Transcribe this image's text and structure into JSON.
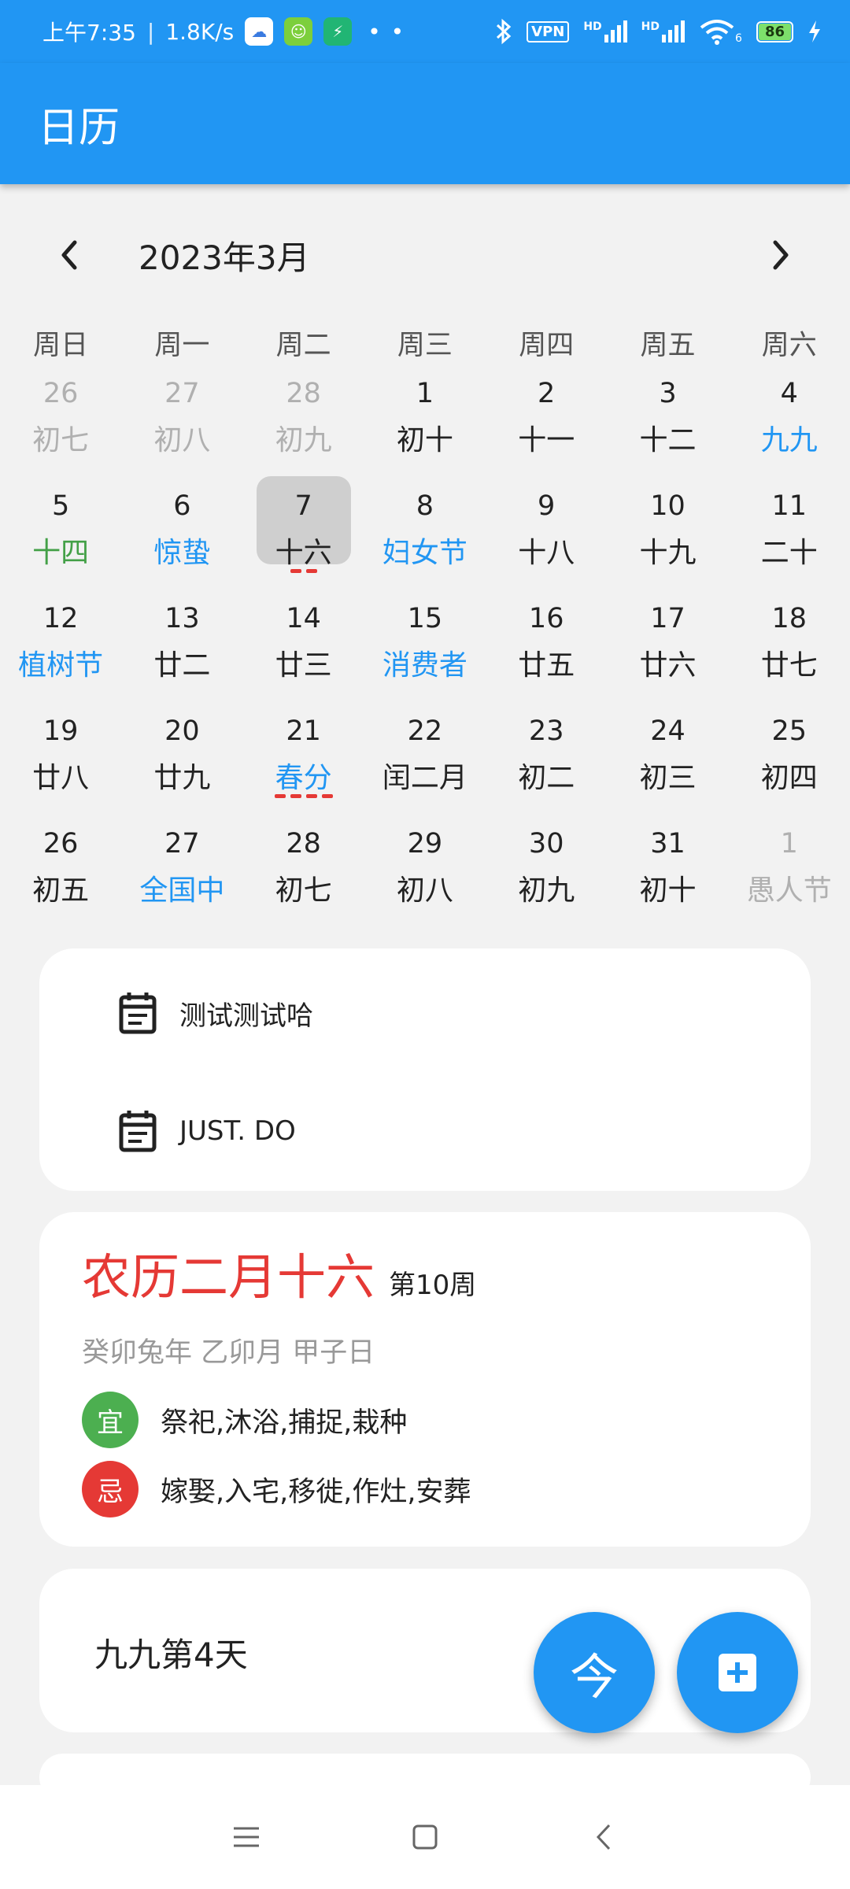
{
  "status_bar": {
    "time": "上午7:35",
    "speed": "1.8K/s",
    "vpn": "VPN",
    "signal1": "HD",
    "signal2": "HD",
    "battery": "86",
    "wifi_index": "6",
    "more": "• •"
  },
  "app_bar": {
    "title": "日历"
  },
  "month_nav": {
    "title": "2023年3月"
  },
  "weekdays": [
    "周日",
    "周一",
    "周二",
    "周三",
    "周四",
    "周五",
    "周六"
  ],
  "calendar": {
    "weeks": [
      [
        {
          "num": "26",
          "lunar": "初七",
          "other": true
        },
        {
          "num": "27",
          "lunar": "初八",
          "other": true
        },
        {
          "num": "28",
          "lunar": "初九",
          "other": true
        },
        {
          "num": "1",
          "lunar": "初十"
        },
        {
          "num": "2",
          "lunar": "十一"
        },
        {
          "num": "3",
          "lunar": "十二"
        },
        {
          "num": "4",
          "lunar": "九九",
          "color": "blue"
        }
      ],
      [
        {
          "num": "5",
          "lunar": "十四",
          "color": "green"
        },
        {
          "num": "6",
          "lunar": "惊蛰",
          "color": "blue"
        },
        {
          "num": "7",
          "lunar": "十六",
          "selected": true,
          "marks": 2
        },
        {
          "num": "8",
          "lunar": "妇女节",
          "color": "blue"
        },
        {
          "num": "9",
          "lunar": "十八"
        },
        {
          "num": "10",
          "lunar": "十九"
        },
        {
          "num": "11",
          "lunar": "二十"
        }
      ],
      [
        {
          "num": "12",
          "lunar": "植树节",
          "color": "blue"
        },
        {
          "num": "13",
          "lunar": "廿二"
        },
        {
          "num": "14",
          "lunar": "廿三"
        },
        {
          "num": "15",
          "lunar": "消费者",
          "color": "blue"
        },
        {
          "num": "16",
          "lunar": "廿五"
        },
        {
          "num": "17",
          "lunar": "廿六"
        },
        {
          "num": "18",
          "lunar": "廿七"
        }
      ],
      [
        {
          "num": "19",
          "lunar": "廿八"
        },
        {
          "num": "20",
          "lunar": "廿九"
        },
        {
          "num": "21",
          "lunar": "春分",
          "color": "blue",
          "marks": 4
        },
        {
          "num": "22",
          "lunar": "闰二月"
        },
        {
          "num": "23",
          "lunar": "初二"
        },
        {
          "num": "24",
          "lunar": "初三"
        },
        {
          "num": "25",
          "lunar": "初四"
        }
      ],
      [
        {
          "num": "26",
          "lunar": "初五"
        },
        {
          "num": "27",
          "lunar": "全国中",
          "color": "blue"
        },
        {
          "num": "28",
          "lunar": "初七"
        },
        {
          "num": "29",
          "lunar": "初八"
        },
        {
          "num": "30",
          "lunar": "初九"
        },
        {
          "num": "31",
          "lunar": "初十"
        },
        {
          "num": "1",
          "lunar": "愚人节",
          "other": true
        }
      ]
    ]
  },
  "todos": {
    "items": [
      {
        "text": "测试测试哈"
      },
      {
        "text": "JUST. DO"
      }
    ]
  },
  "lunar_info": {
    "date": "农历二月十六",
    "week": "第10周",
    "ganzhi": "癸卯兔年 乙卯月 甲子日",
    "yi_label": "宜",
    "yi": "祭祀,沐浴,捕捉,栽种",
    "ji_label": "忌",
    "ji": "嫁娶,入宅,移徙,作灶,安葬"
  },
  "jiujiu": {
    "text": "九九第4天"
  },
  "fab": {
    "today_label": "今"
  },
  "colors": {
    "primary": "#2196f3",
    "lunar_red": "#e53935",
    "yi_green": "#4caf50",
    "holiday_blue": "#2196f3",
    "term_green": "#43a047"
  }
}
